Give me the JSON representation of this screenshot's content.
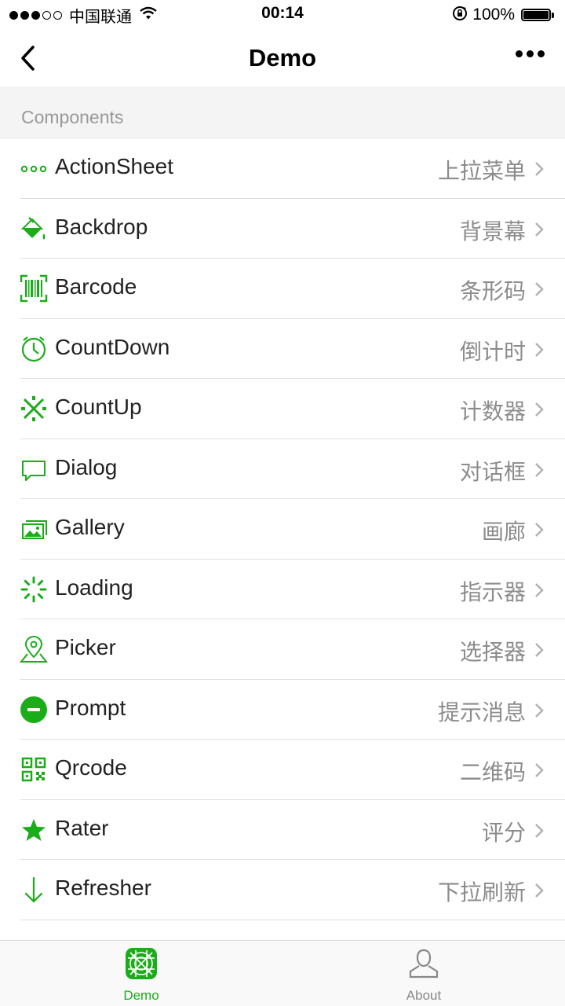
{
  "status_bar": {
    "carrier": "中国联通",
    "signal_bars": 3,
    "signal_total": 5,
    "time": "00:14",
    "battery": "100%",
    "battery_level": 1.0
  },
  "nav": {
    "title": "Demo",
    "back_icon": "chevron-left-icon",
    "more_icon": "more-dots-icon"
  },
  "section": {
    "title": "Components"
  },
  "accent_color": "#1aad19",
  "items": [
    {
      "title": "ActionSheet",
      "desc": "上拉菜单",
      "icon": "dots-icon"
    },
    {
      "title": "Backdrop",
      "desc": "背景幕",
      "icon": "paint-bucket-icon"
    },
    {
      "title": "Barcode",
      "desc": "条形码",
      "icon": "barcode-icon"
    },
    {
      "title": "CountDown",
      "desc": "倒计时",
      "icon": "clock-icon"
    },
    {
      "title": "CountUp",
      "desc": "计数器",
      "icon": "counter-icon"
    },
    {
      "title": "Dialog",
      "desc": "对话框",
      "icon": "chat-bubble-icon"
    },
    {
      "title": "Gallery",
      "desc": "画廊",
      "icon": "gallery-icon"
    },
    {
      "title": "Loading",
      "desc": "指示器",
      "icon": "spinner-icon"
    },
    {
      "title": "Picker",
      "desc": "选择器",
      "icon": "location-pin-icon"
    },
    {
      "title": "Prompt",
      "desc": "提示消息",
      "icon": "minus-circle-icon"
    },
    {
      "title": "Qrcode",
      "desc": "二维码",
      "icon": "qrcode-icon"
    },
    {
      "title": "Rater",
      "desc": "评分",
      "icon": "star-icon"
    },
    {
      "title": "Refresher",
      "desc": "下拉刷新",
      "icon": "arrow-down-icon"
    }
  ],
  "tabs": [
    {
      "label": "Demo",
      "icon": "demo-grid-icon",
      "active": true
    },
    {
      "label": "About",
      "icon": "user-icon",
      "active": false
    }
  ]
}
